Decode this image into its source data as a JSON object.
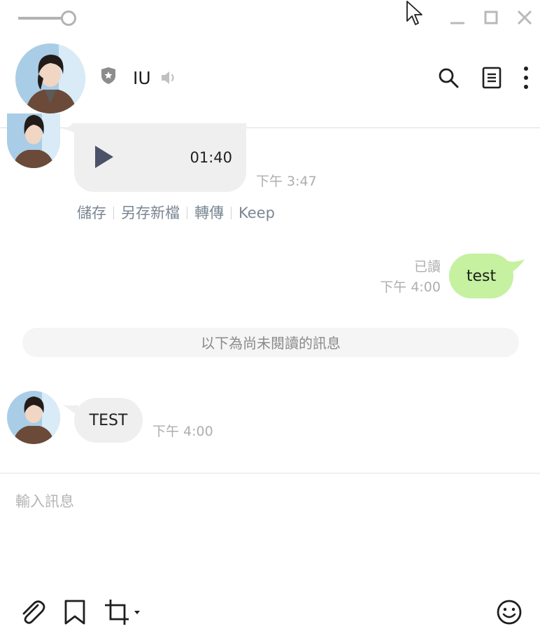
{
  "window": {
    "controls": [
      "minimize-icon",
      "maximize-icon",
      "close-icon"
    ]
  },
  "header": {
    "contact_name": "IU",
    "icons": [
      "shield-star-icon",
      "speaker-icon",
      "search-icon",
      "notes-icon",
      "more-vert-icon"
    ]
  },
  "messages": {
    "voice": {
      "duration": "01:40",
      "time": "下午 3:47",
      "actions": [
        "儲存",
        "另存新檔",
        "轉傳",
        "Keep"
      ]
    },
    "sent": {
      "text": "test",
      "read_receipt": "已讀",
      "time": "下午 4:00"
    },
    "unread_divider": "以下為尚未閱讀的訊息",
    "received": {
      "text": "TEST",
      "time": "下午 4:00"
    }
  },
  "composer": {
    "placeholder": "輸入訊息",
    "tools": [
      "paperclip-icon",
      "bookmark-icon",
      "crop-icon",
      "emoji-icon"
    ]
  },
  "colors": {
    "sent_bubble": "#c5f1a0",
    "received_bubble": "#efefef",
    "timestamp": "#aeaeae",
    "action_link": "#7a8694"
  }
}
